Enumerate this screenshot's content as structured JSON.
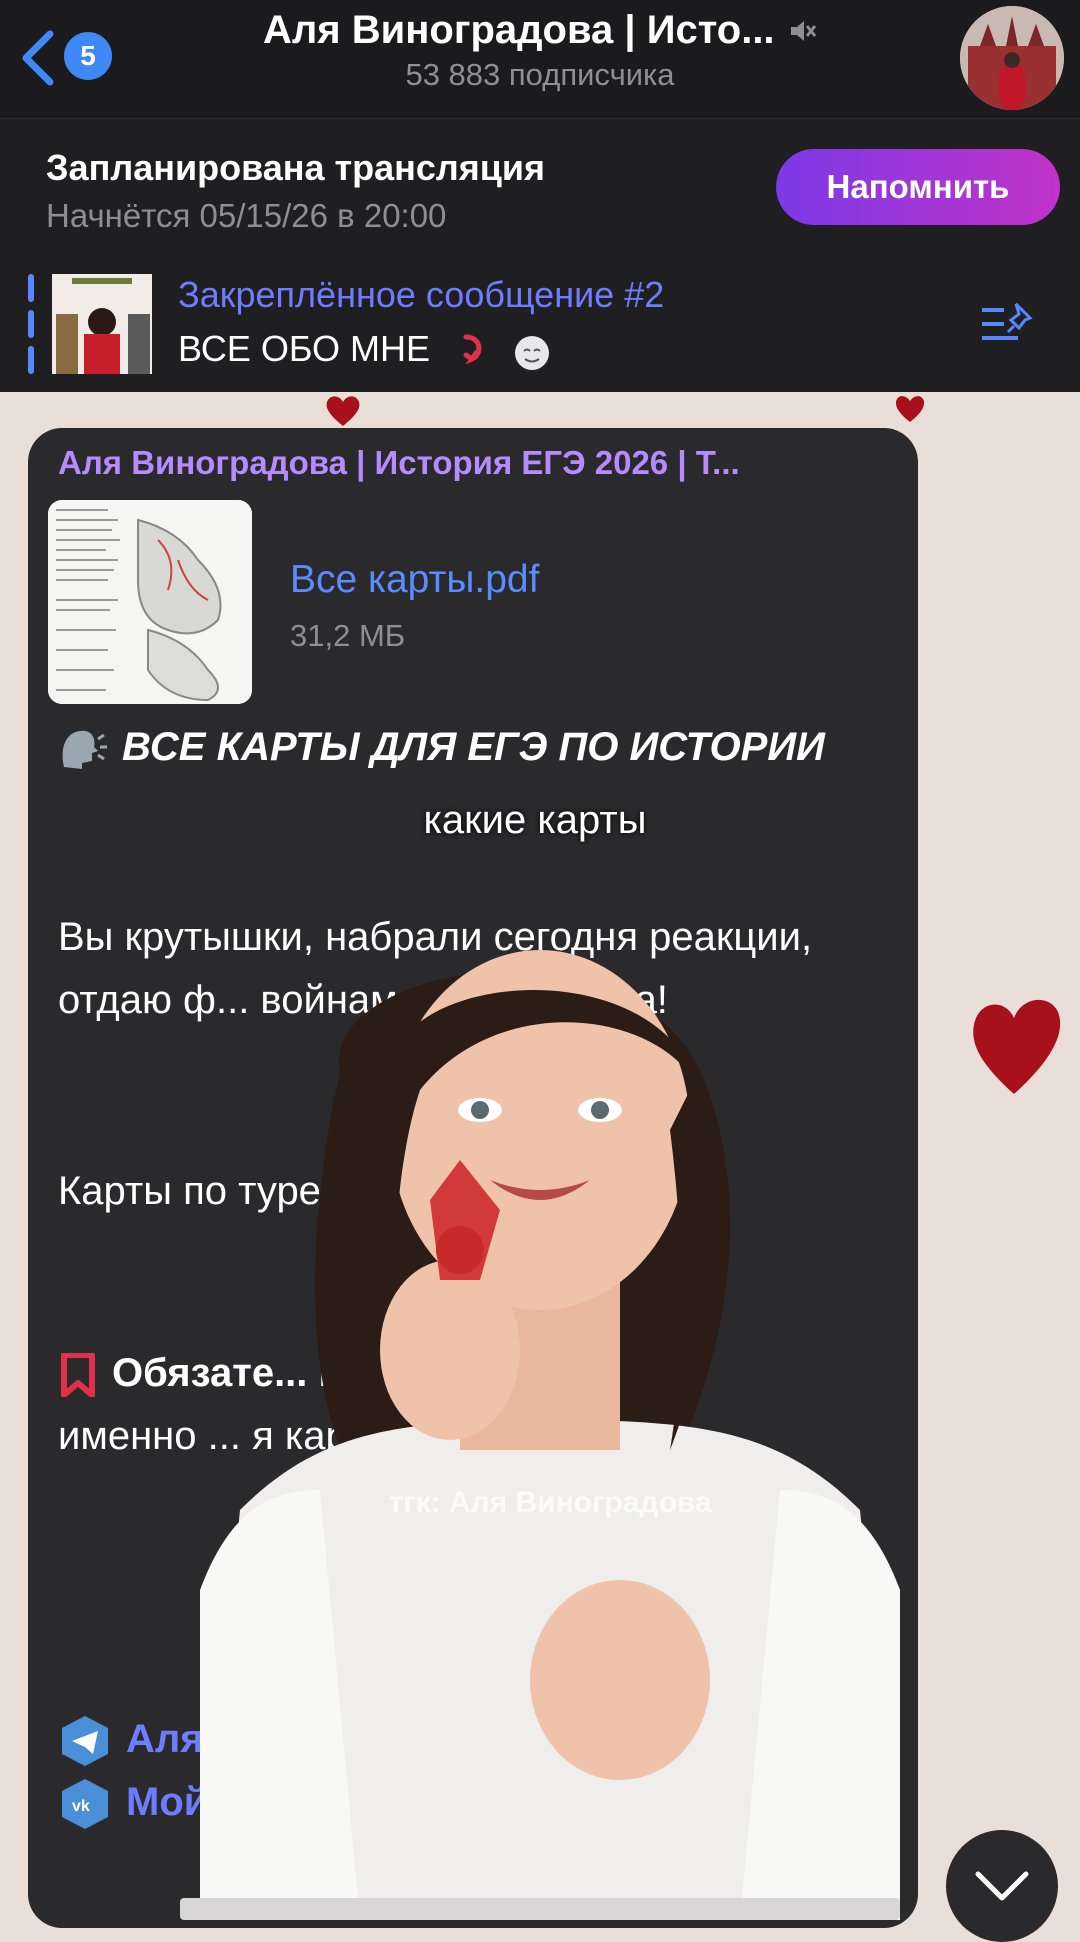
{
  "navbar": {
    "back_count": "5",
    "channel_title": "Аля Виноградова | Исто...",
    "subscribers": "53 883 подписчика"
  },
  "live": {
    "title": "Запланирована трансляция",
    "starts": "Начнётся 05/15/26 в 20:00",
    "remind_label": "Напомнить"
  },
  "pinned": {
    "title": "Закреплённое сообщение #2",
    "text": "ВСЕ ОБО МНЕ"
  },
  "message": {
    "sender": "Аля Виноградова | История ЕГЭ 2026 | Т...",
    "file_name": "Все карты.pdf",
    "file_size": "31,2 МБ",
    "headline": "ВСЕ КАРТЫ ДЛЯ ЕГЭ ПО ИСТОРИИ",
    "p1": "Вы крутышки, набрали сегодня реакции, отдаю ф... войнам, как обещала!",
    "p2": "Карты по туре... там тоже, конечн...",
    "p3_bold": "Обязате... внимани...",
    "p3_rest": "именно ... я карта пе... е намного...",
    "link1": "Аля ... истори...",
    "link2": "Мой ... Вк"
  },
  "overlay": {
    "caption": "какие карты",
    "watermark": "тгк: Аля Виноградова"
  },
  "colors": {
    "accent_purple": "#b48cff",
    "link_blue": "#5a8cff",
    "bubble": "#2a2a2c"
  }
}
